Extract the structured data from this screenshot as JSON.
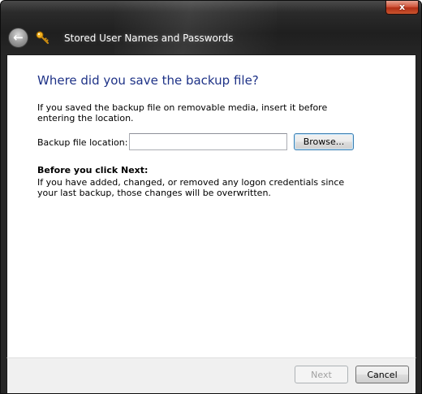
{
  "window": {
    "title": "Stored User Names and Passwords",
    "close_label": "x"
  },
  "nav": {
    "back_icon": "back-arrow-icon",
    "app_icon": "key-icon"
  },
  "content": {
    "heading": "Where did you save the backup file?",
    "intro": "If you saved the backup file on removable media, insert it before entering the location.",
    "location_label": "Backup file location:",
    "location_value": "",
    "browse_label": "Browse...",
    "warning_title": "Before you click Next:",
    "warning_text": "If you have added, changed, or removed any logon credentials since your last backup, those changes will be overwritten."
  },
  "footer": {
    "next_label": "Next",
    "cancel_label": "Cancel"
  },
  "colors": {
    "heading": "#1e3287",
    "frame": "#262626",
    "close_button": "#c9552f"
  }
}
